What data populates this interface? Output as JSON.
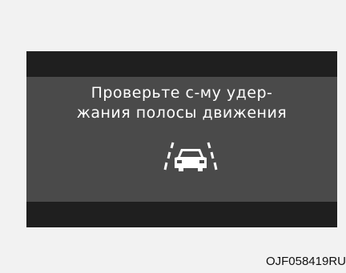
{
  "display": {
    "message_line1": "Проверьте с-му удер-",
    "message_line2": "жания полосы движения",
    "icon": "lane-keeping-assist-icon"
  },
  "figure_code": "OJF058419RU",
  "colors": {
    "page_bg": "#f2f2f2",
    "screen_bg": "#4a4a4a",
    "band": "#1f1f1f",
    "text": "#ffffff"
  }
}
